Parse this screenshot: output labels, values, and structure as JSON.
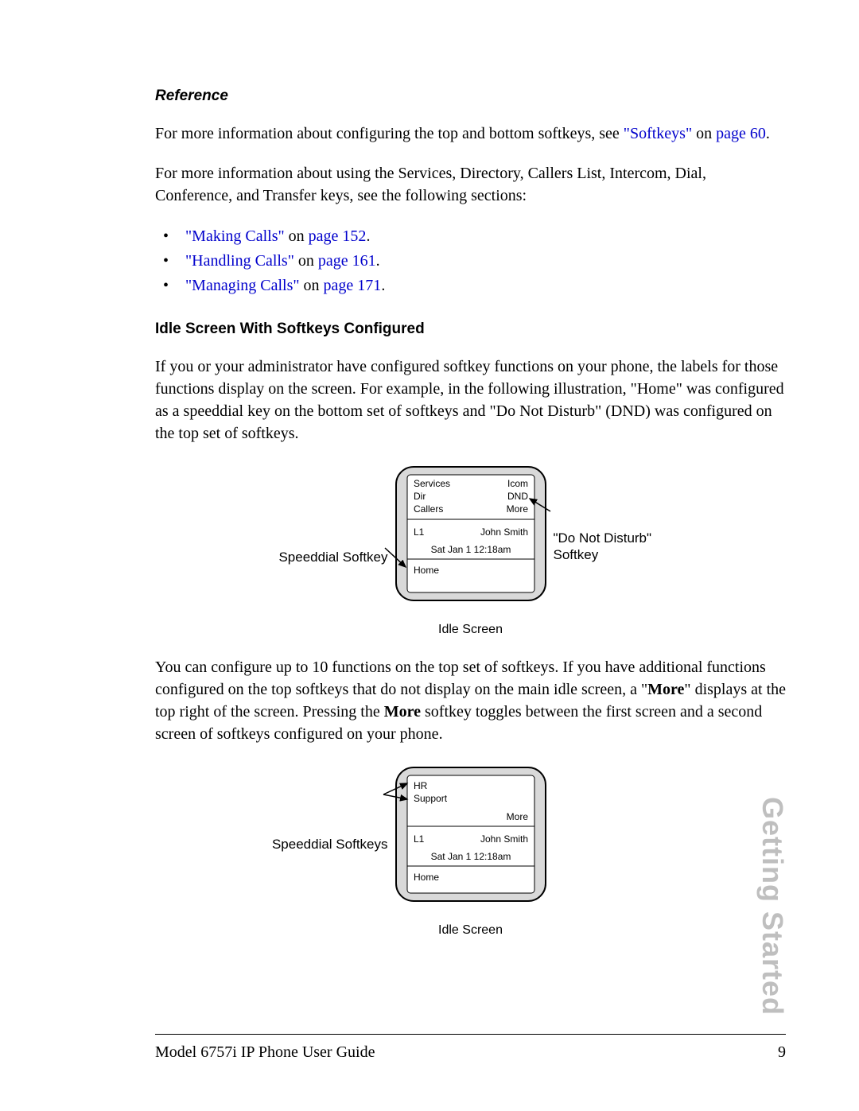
{
  "reference": {
    "heading": "Reference",
    "para1_prefix": "For more information about configuring the top and bottom softkeys, see ",
    "para1_link": "\"Softkeys\"",
    "para1_mid": " on ",
    "para1_link2": "page 60",
    "para1_suffix": ".",
    "para2": "For more information about using the Services, Directory, Callers List, Intercom, Dial, Conference, and Transfer keys, see the following sections:",
    "bullets": [
      {
        "link": "\"Making Calls\"",
        "mid": " on ",
        "page": "page 152",
        "suffix": "."
      },
      {
        "link": "\"Handling Calls\"",
        "mid": " on ",
        "page": "page 161",
        "suffix": "."
      },
      {
        "link": "\"Managing Calls\"",
        "mid": " on ",
        "page": "page 171",
        "suffix": "."
      }
    ]
  },
  "section2": {
    "heading": "Idle Screen With Softkeys Configured",
    "para1": "If you or your administrator have configured softkey functions on your phone, the labels for those functions display on the screen. For example, in the following illustration, \"Home\" was configured as a speeddial key on the bottom set of softkeys and \"Do Not Disturb\" (DND) was configured on the top set of softkeys."
  },
  "figure1": {
    "left_callout": "Speeddial Softkey",
    "right_callout_line1": "\"Do Not Disturb\"",
    "right_callout_line2": "Softkey",
    "screen": {
      "top_left": [
        "Services",
        "Dir",
        "Callers"
      ],
      "top_right": [
        "Icom",
        "DND",
        "More"
      ],
      "line_label": "L1",
      "line_name": "John Smith",
      "datetime": "Sat Jan 1 12:18am",
      "bottom_left": "Home"
    },
    "caption": "Idle Screen"
  },
  "section3": {
    "para_pre": "You can configure up to 10 functions on the top set of softkeys. If you have additional functions configured on the top softkeys that do not display on the main idle screen, a \"",
    "bold1": "More",
    "para_mid": "\" displays at the top right of the screen. Pressing the ",
    "bold2": "More",
    "para_post": " softkey toggles between the first screen and a second screen of softkeys configured on your phone."
  },
  "figure2": {
    "left_callout": "Speeddial Softkeys",
    "screen": {
      "top_left": [
        "HR",
        "Support"
      ],
      "top_right_more": "More",
      "line_label": "L1",
      "line_name": "John Smith",
      "datetime": "Sat Jan 1 12:18am",
      "bottom_left": "Home"
    },
    "caption": "Idle Screen"
  },
  "side_tab": "Getting Started",
  "footer": {
    "left": "Model 6757i IP Phone User Guide",
    "right": "9"
  }
}
